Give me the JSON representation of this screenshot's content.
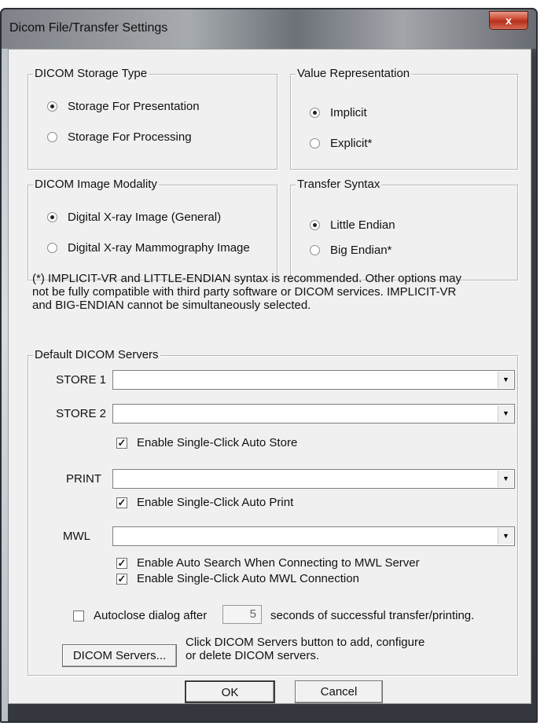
{
  "window": {
    "title": "Dicom File/Transfer Settings",
    "close_glyph": "x"
  },
  "storage_type": {
    "legend": "DICOM Storage Type",
    "options": [
      {
        "label": "Storage For Presentation",
        "selected": true
      },
      {
        "label": "Storage For Processing",
        "selected": false
      }
    ]
  },
  "value_rep": {
    "legend": "Value Representation",
    "options": [
      {
        "label": "Implicit",
        "selected": true
      },
      {
        "label": "Explicit*",
        "selected": false
      }
    ]
  },
  "modality": {
    "legend": "DICOM Image Modality",
    "options": [
      {
        "label": "Digital X-ray Image (General)",
        "selected": true
      },
      {
        "label": "Digital X-ray Mammography Image",
        "selected": false
      }
    ]
  },
  "transfer_syntax": {
    "legend": "Transfer Syntax",
    "options": [
      {
        "label": "Little Endian",
        "selected": true
      },
      {
        "label": "Big Endian*",
        "selected": false
      }
    ]
  },
  "note": {
    "line1": "(*) IMPLICIT-VR  and LITTLE-ENDIAN syntax is recommended. Other options may",
    "line2": "not be fully compatible with third party software or DICOM services. IMPLICIT-VR",
    "line3": "and BIG-ENDIAN cannot be simultaneously selected."
  },
  "servers": {
    "legend": "Default DICOM Servers",
    "store1_label": "STORE 1",
    "store1_value": "",
    "store2_label": "STORE 2",
    "store2_value": "",
    "auto_store_label": "Enable Single-Click Auto Store",
    "auto_store_checked": true,
    "print_label": "PRINT",
    "print_value": "",
    "auto_print_label": "Enable Single-Click Auto Print",
    "auto_print_checked": true,
    "mwl_label": "MWL",
    "mwl_value": "",
    "auto_search_label": "Enable Auto Search When Connecting to MWL Server",
    "auto_search_checked": true,
    "auto_mwl_label": "Enable Single-Click Auto MWL Connection",
    "auto_mwl_checked": true,
    "autoclose_prefix": "Autoclose dialog after",
    "autoclose_seconds": "5",
    "autoclose_suffix": "seconds of successful transfer/printing.",
    "autoclose_checked": false,
    "servers_button": "DICOM Servers...",
    "help_line1": "Click DICOM Servers button to add, configure",
    "help_line2": "or delete DICOM servers."
  },
  "buttons": {
    "ok": "OK",
    "cancel": "Cancel"
  },
  "glyphs": {
    "dropdown_arrow": "▼",
    "check_mark": "✓"
  },
  "colors": {
    "close_button": "#c9432c",
    "dialog_face": "#f0f0f0",
    "frame": "#3a3d44"
  }
}
